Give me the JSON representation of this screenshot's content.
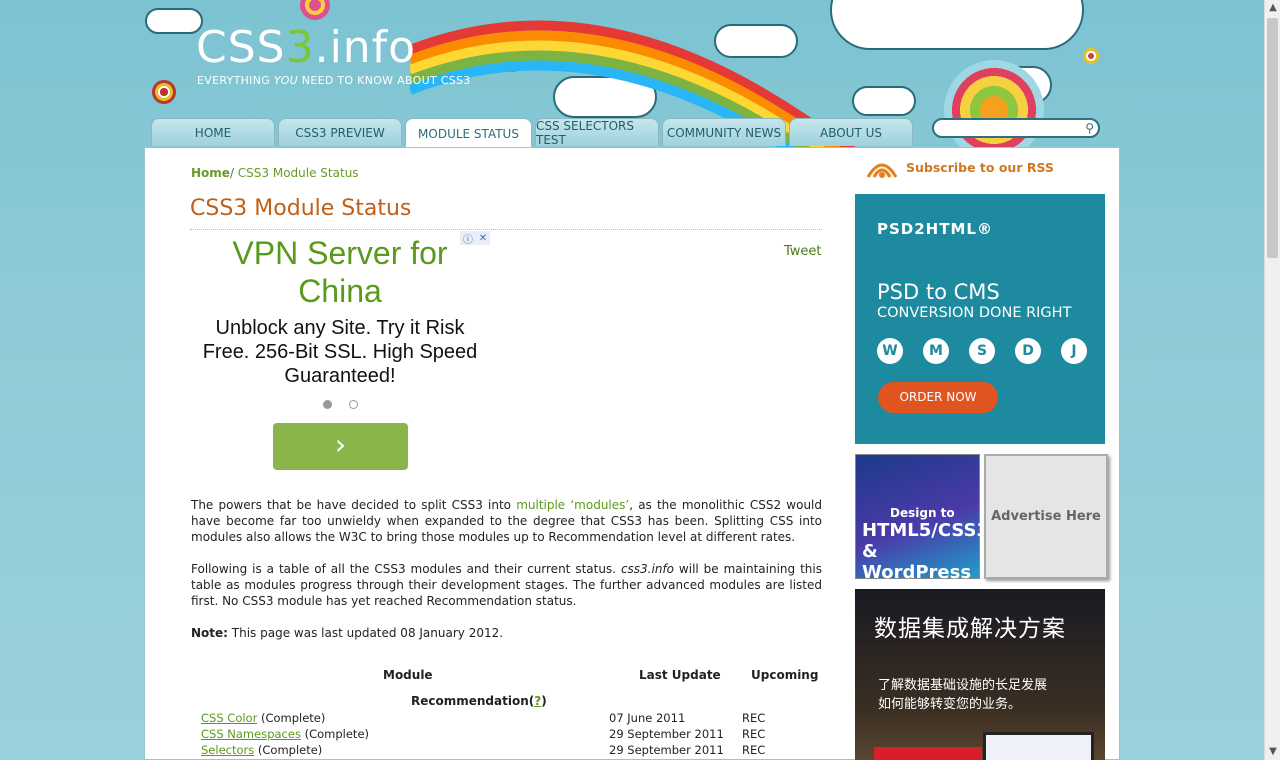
{
  "site": {
    "logo_prefix": "CSS",
    "logo_number": "3",
    "logo_suffix": ".info",
    "tagline_a": "EVERYTHING ",
    "tagline_em": "YOU",
    "tagline_b": " NEED TO KNOW ABOUT CSS3"
  },
  "nav": {
    "tabs": [
      {
        "label": "HOME"
      },
      {
        "label": "CSS3 PREVIEW"
      },
      {
        "label": "MODULE STATUS",
        "active": true
      },
      {
        "label": "CSS SELECTORS TEST"
      },
      {
        "label": "COMMUNITY NEWS"
      },
      {
        "label": "ABOUT US"
      }
    ],
    "search_placeholder": "",
    "search_icon": "magnifier-icon"
  },
  "breadcrumb": {
    "home": "Home",
    "sep": "/",
    "current": " CSS3 Module Status"
  },
  "page_title": "CSS3 Module Status",
  "tweet": "Tweet",
  "ad": {
    "headline": "VPN Server for China",
    "body": "Unblock any Site. Try it Risk Free. 256-Bit SSL. High Speed Guaranteed!",
    "go_glyph": "›",
    "adchoices": [
      "ⓘ",
      "✕"
    ]
  },
  "intro": {
    "p1_a": "The powers that be have decided to split CSS3 into ",
    "p1_link": "multiple ‘modules’",
    "p1_b": ", as the monolithic CSS2 would have become far too unwieldy when expanded to the degree that CSS3 has been. Splitting CSS into modules also allows the W3C to bring those modules up to Recommendation level at different rates.",
    "p2_a": "Following is a table of all the CSS3 modules and their current status. ",
    "p2_em": "css3.info",
    "p2_b": " will be maintaining this table as modules progress through their development stages. The further advanced modules are listed first. No CSS3 module has yet reached Recommendation status.",
    "note_label": "Note:",
    "note_text": " This page was last updated 08 January 2012."
  },
  "table": {
    "headers": {
      "module": "Module",
      "last_update": "Last Update",
      "upcoming": "Upcoming"
    },
    "section": "Recommendation(",
    "section_q": "?",
    "section_end": ")",
    "rows": [
      {
        "module": "CSS Color",
        "status": " (Complete)",
        "date": "07 June 2011",
        "upcoming": "REC"
      },
      {
        "module": "CSS Namespaces",
        "status": " (Complete)",
        "date": "29 September 2011",
        "upcoming": "REC"
      },
      {
        "module": "Selectors",
        "status": " (Complete)",
        "date": "29 September 2011",
        "upcoming": "REC"
      }
    ]
  },
  "sidebar": {
    "rss_label": "Subscribe to our RSS",
    "psd": {
      "brand": "PSD2HTML®",
      "line1": "PSD to CMS",
      "line2": "CONVERSION DONE RIGHT",
      "cms_icons": [
        "W",
        "M",
        "S",
        "D",
        "J"
      ],
      "cta": "ORDER NOW"
    },
    "html5_ad": {
      "a": "Design to",
      "b": "HTML5/CSS3 & WordPress"
    },
    "advertise": "Advertise Here",
    "cn_ad": {
      "headline": "数据集成解决方案",
      "sub1": "了解数据基础设施的长足发展",
      "sub2": "如何能够转变您的业务。"
    }
  },
  "colors": {
    "accent_green": "#5a9a1a",
    "title_orange": "#c06018",
    "rss_orange": "#d07820",
    "sky": "#8fcad6"
  }
}
